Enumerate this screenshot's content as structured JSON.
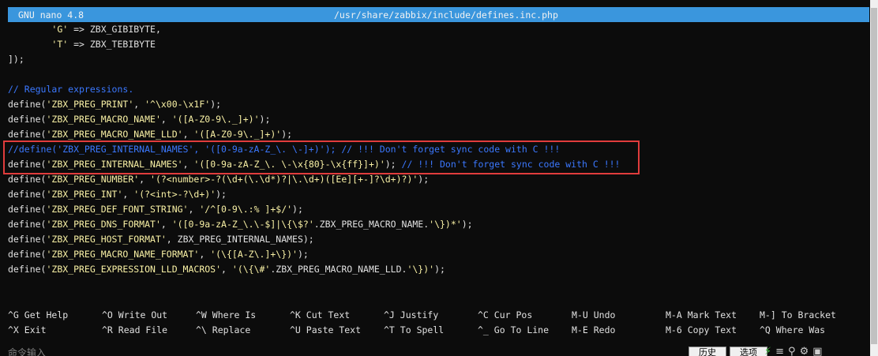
{
  "titlebar": {
    "app": "GNU nano 4.8",
    "path": "/usr/share/zabbix/include/defines.inc.php"
  },
  "editor_lines": [
    [
      {
        "t": "\t",
        "c": "plain"
      },
      {
        "t": "'G'",
        "c": "str"
      },
      {
        "t": " => ZBX_GIBIBYTE,",
        "c": "plain"
      }
    ],
    [
      {
        "t": "\t",
        "c": "plain"
      },
      {
        "t": "'T'",
        "c": "str"
      },
      {
        "t": " => ZBX_TEBIBYTE",
        "c": "plain"
      }
    ],
    [
      {
        "t": "]);",
        "c": "plain"
      }
    ],
    [
      {
        "t": "",
        "c": "plain"
      }
    ],
    [
      {
        "t": "// Regular expressions.",
        "c": "cmt"
      }
    ],
    [
      {
        "t": "define(",
        "c": "plain"
      },
      {
        "t": "'ZBX_PREG_PRINT'",
        "c": "str"
      },
      {
        "t": ", ",
        "c": "plain"
      },
      {
        "t": "'^\\x00-\\x1F'",
        "c": "str"
      },
      {
        "t": ");",
        "c": "plain"
      }
    ],
    [
      {
        "t": "define(",
        "c": "plain"
      },
      {
        "t": "'ZBX_PREG_MACRO_NAME'",
        "c": "str"
      },
      {
        "t": ", ",
        "c": "plain"
      },
      {
        "t": "'([A-Z0-9\\._]+)'",
        "c": "str"
      },
      {
        "t": ");",
        "c": "plain"
      }
    ],
    [
      {
        "t": "define(",
        "c": "plain"
      },
      {
        "t": "'ZBX_PREG_MACRO_NAME_LLD'",
        "c": "str"
      },
      {
        "t": ", ",
        "c": "plain"
      },
      {
        "t": "'([A-Z0-9\\._]+)'",
        "c": "str"
      },
      {
        "t": ");",
        "c": "plain"
      }
    ],
    [
      {
        "t": "//define('ZBX_PREG_INTERNAL_NAMES', '([0-9a-zA-Z_\\. \\-]+)'); // !!! Don't forget sync code with C !!!",
        "c": "cmt"
      }
    ],
    [
      {
        "t": "define(",
        "c": "plain"
      },
      {
        "t": "'ZBX_PREG_INTERNAL_NAMES'",
        "c": "str"
      },
      {
        "t": ", ",
        "c": "plain"
      },
      {
        "t": "'([0-9a-zA-Z_\\. \\-\\x{80}-\\x{ff}]+)'",
        "c": "str"
      },
      {
        "t": "); ",
        "c": "plain"
      },
      {
        "t": "// !!! Don't forget sync code with C !!!",
        "c": "cmt"
      }
    ],
    [
      {
        "t": "define(",
        "c": "plain"
      },
      {
        "t": "'ZBX_PREG_NUMBER'",
        "c": "str"
      },
      {
        "t": ", ",
        "c": "plain"
      },
      {
        "t": "'(?<number>-?(\\d+(\\.\\d*)?|\\.\\d+)([Ee][+-]?\\d+)?)'",
        "c": "str"
      },
      {
        "t": ");",
        "c": "plain"
      }
    ],
    [
      {
        "t": "define(",
        "c": "plain"
      },
      {
        "t": "'ZBX_PREG_INT'",
        "c": "str"
      },
      {
        "t": ", ",
        "c": "plain"
      },
      {
        "t": "'(?<int>-?\\d+)'",
        "c": "str"
      },
      {
        "t": ");",
        "c": "plain"
      }
    ],
    [
      {
        "t": "define(",
        "c": "plain"
      },
      {
        "t": "'ZBX_PREG_DEF_FONT_STRING'",
        "c": "str"
      },
      {
        "t": ", ",
        "c": "plain"
      },
      {
        "t": "'/^[0-9\\.:% ]+$/'",
        "c": "str"
      },
      {
        "t": ");",
        "c": "plain"
      }
    ],
    [
      {
        "t": "define(",
        "c": "plain"
      },
      {
        "t": "'ZBX_PREG_DNS_FORMAT'",
        "c": "str"
      },
      {
        "t": ", ",
        "c": "plain"
      },
      {
        "t": "'([0-9a-zA-Z_\\.\\-$]|\\{\\$?'",
        "c": "str"
      },
      {
        "t": ".ZBX_PREG_MACRO_NAME.",
        "c": "plain"
      },
      {
        "t": "'\\})*'",
        "c": "str"
      },
      {
        "t": ");",
        "c": "plain"
      }
    ],
    [
      {
        "t": "define(",
        "c": "plain"
      },
      {
        "t": "'ZBX_PREG_HOST_FORMAT'",
        "c": "str"
      },
      {
        "t": ", ZBX_PREG_INTERNAL_NAMES);",
        "c": "plain"
      }
    ],
    [
      {
        "t": "define(",
        "c": "plain"
      },
      {
        "t": "'ZBX_PREG_MACRO_NAME_FORMAT'",
        "c": "str"
      },
      {
        "t": ", ",
        "c": "plain"
      },
      {
        "t": "'(\\{[A-Z\\.]+\\})'",
        "c": "str"
      },
      {
        "t": ");",
        "c": "plain"
      }
    ],
    [
      {
        "t": "define(",
        "c": "plain"
      },
      {
        "t": "'ZBX_PREG_EXPRESSION_LLD_MACROS'",
        "c": "str"
      },
      {
        "t": ", ",
        "c": "plain"
      },
      {
        "t": "'(\\{\\#'",
        "c": "str"
      },
      {
        "t": ".ZBX_PREG_MACRO_NAME_LLD.",
        "c": "plain"
      },
      {
        "t": "'\\})'",
        "c": "str"
      },
      {
        "t": ");",
        "c": "plain"
      }
    ]
  ],
  "shortcuts": {
    "row1": [
      {
        "key": "^G",
        "label": "Get Help"
      },
      {
        "key": "^O",
        "label": "Write Out"
      },
      {
        "key": "^W",
        "label": "Where Is"
      },
      {
        "key": "^K",
        "label": "Cut Text"
      },
      {
        "key": "^J",
        "label": "Justify"
      },
      {
        "key": "^C",
        "label": "Cur Pos"
      },
      {
        "key": "M-U",
        "label": "Undo"
      },
      {
        "key": "M-A",
        "label": "Mark Text"
      },
      {
        "key": "M-]",
        "label": "To Bracket"
      }
    ],
    "row2": [
      {
        "key": "^X",
        "label": "Exit"
      },
      {
        "key": "^R",
        "label": "Read File"
      },
      {
        "key": "^\\",
        "label": "Replace"
      },
      {
        "key": "^U",
        "label": "Paste Text"
      },
      {
        "key": "^T",
        "label": "To Spell"
      },
      {
        "key": "^_",
        "label": "Go To Line"
      },
      {
        "key": "M-E",
        "label": "Redo"
      },
      {
        "key": "M-6",
        "label": "Copy Text"
      },
      {
        "key": "^Q",
        "label": "Where Was"
      }
    ]
  },
  "bottombar": {
    "command_input": "命令输入",
    "history_button": "历史",
    "options_button": "选项"
  },
  "colors": {
    "titlebar_bg": "#3a96dd",
    "string": "#f9f1a5",
    "comment": "#3b78ff",
    "highlight_border": "#e03c3c"
  }
}
